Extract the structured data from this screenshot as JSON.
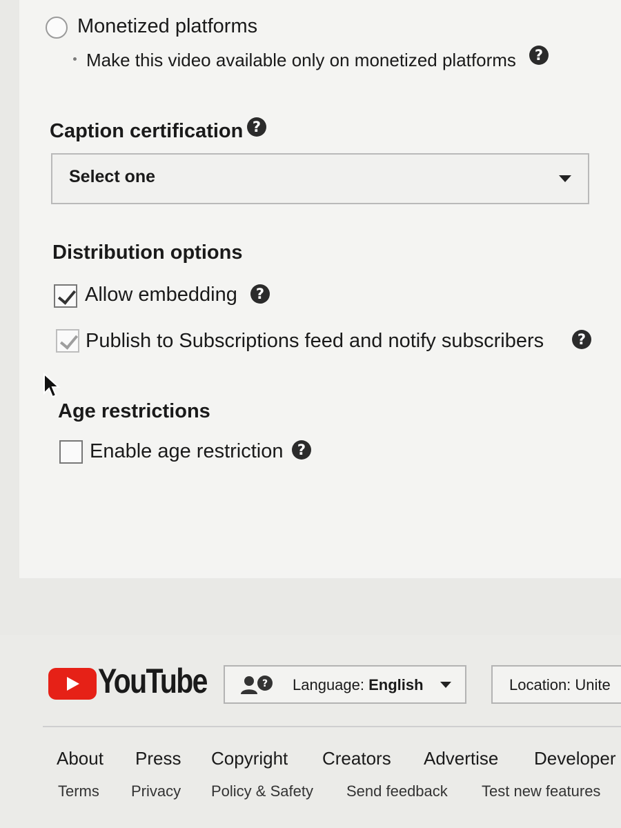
{
  "monetized": {
    "label": "Monetized platforms",
    "description": "Make this video available only on monetized platforms",
    "help_icon": "?"
  },
  "caption": {
    "title": "Caption certification",
    "help_icon": "?",
    "select_value": "Select one"
  },
  "distribution": {
    "title": "Distribution options",
    "allow_embedding": {
      "label": "Allow embedding",
      "checked": true,
      "help_icon": "?"
    },
    "publish_subscriptions": {
      "label": "Publish to Subscriptions feed and notify subscribers",
      "checked": true,
      "disabled": true,
      "help_icon": "?"
    }
  },
  "age": {
    "title": "Age restrictions",
    "enable": {
      "label": "Enable age restriction",
      "checked": false,
      "help_icon": "?"
    }
  },
  "footer": {
    "brand": "YouTube",
    "language_prefix": "Language: ",
    "language_value": "English",
    "location_prefix": "Location: ",
    "location_value": "Unite",
    "links": [
      "About",
      "Press",
      "Copyright",
      "Creators",
      "Advertise",
      "Developer"
    ],
    "sublinks": [
      "Terms",
      "Privacy",
      "Policy & Safety",
      "Send feedback",
      "Test new features"
    ]
  },
  "colors": {
    "youtube_red": "#e62117",
    "icon_dark": "#2b2b2b"
  }
}
